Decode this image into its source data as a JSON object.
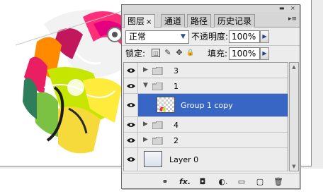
{
  "panel": {
    "tabs": [
      {
        "label": "图层",
        "close": "×"
      },
      {
        "label": "通道"
      },
      {
        "label": "路径"
      },
      {
        "label": "历史记录"
      }
    ],
    "system_buttons": {
      "minimize": "▬",
      "close": "×"
    },
    "menu_icon": "▸≡",
    "blend_mode": "正常",
    "opacity_label": "不透明度:",
    "opacity_value": "100%",
    "lock_label": "锁定:",
    "fill_label": "填充:",
    "fill_value": "100%",
    "slider_arrow": "▶",
    "dropdown_arrow": "▼",
    "lock_icons": [
      "lock-transparent-icon",
      "lock-brush-icon",
      "lock-move-icon",
      "lock-all-icon"
    ],
    "lock_glyphs": [
      "◫",
      "✎",
      "✥",
      "🔒"
    ]
  },
  "layers": [
    {
      "name": "3",
      "type": "group",
      "expanded": false,
      "selected": false
    },
    {
      "name": "1",
      "type": "group",
      "expanded": true,
      "selected": false
    },
    {
      "name": "Group 1 copy",
      "type": "layer",
      "selected": true
    },
    {
      "name": "4",
      "type": "group",
      "expanded": false,
      "selected": false
    },
    {
      "name": "2",
      "type": "group",
      "expanded": false,
      "selected": false
    },
    {
      "name": "Layer 0",
      "type": "layer",
      "selected": false
    }
  ],
  "expanders": {
    "collapsed": "▶",
    "expanded": "▼"
  },
  "bottom_toolbar": [
    {
      "icon": "link-layers-icon",
      "glyph": "⚭"
    },
    {
      "icon": "layer-style-icon",
      "glyph": "fx."
    },
    {
      "icon": "layer-mask-icon",
      "glyph": "◘"
    },
    {
      "icon": "adjustment-layer-icon",
      "glyph": "◐."
    },
    {
      "icon": "new-group-icon",
      "glyph": "▭"
    },
    {
      "icon": "new-layer-icon",
      "glyph": "▢"
    },
    {
      "icon": "delete-layer-icon",
      "glyph": "🗑"
    }
  ],
  "colors": {
    "selection": "#3766c4",
    "panel_bg": "#ececec",
    "accent_arrow": "#1e3f80"
  }
}
